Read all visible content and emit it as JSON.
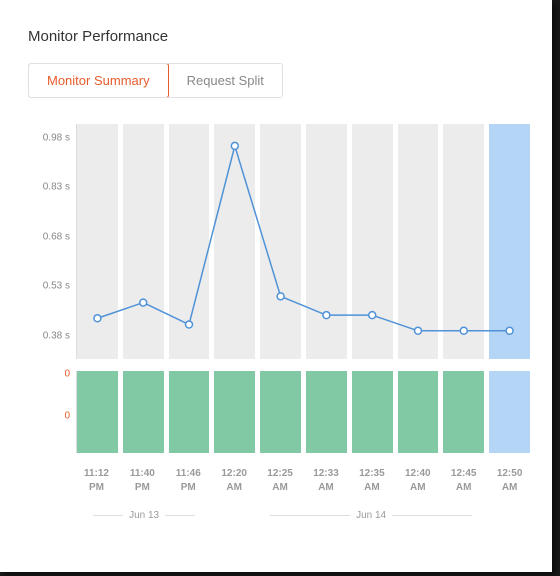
{
  "title": "Monitor Performance",
  "tabs": [
    {
      "label": "Monitor Summary",
      "active": true
    },
    {
      "label": "Request Split",
      "active": false
    }
  ],
  "chart_data": [
    {
      "type": "line",
      "ylabel": "",
      "yticks": [
        "0.98 s",
        "0.83 s",
        "0.68 s",
        "0.53 s",
        "0.38 s"
      ],
      "ylim": [
        0.3,
        1.05
      ],
      "categories": [
        "11:12 PM",
        "11:40 PM",
        "11:46 PM",
        "12:20 AM",
        "12:25 AM",
        "12:33 AM",
        "12:35 AM",
        "12:40 AM",
        "12:45 AM",
        "12:50 AM"
      ],
      "values": [
        0.43,
        0.48,
        0.41,
        0.98,
        0.5,
        0.44,
        0.44,
        0.39,
        0.39,
        0.39
      ],
      "highlight_index": 9
    },
    {
      "type": "bar",
      "ylabel": "",
      "yticks": [
        "0",
        "0"
      ],
      "ylim": [
        0,
        1
      ],
      "categories": [
        "11:12 PM",
        "11:40 PM",
        "11:46 PM",
        "12:20 AM",
        "12:25 AM",
        "12:33 AM",
        "12:35 AM",
        "12:40 AM",
        "12:45 AM",
        "12:50 AM"
      ],
      "values": [
        1,
        1,
        1,
        1,
        1,
        1,
        1,
        1,
        1,
        0
      ],
      "highlight_index": 9
    }
  ],
  "x_times": [
    "11:12",
    "11:40",
    "11:46",
    "12:20",
    "12:25",
    "12:33",
    "12:35",
    "12:40",
    "12:45",
    "12:50"
  ],
  "x_ampm": [
    "PM",
    "PM",
    "PM",
    "AM",
    "AM",
    "AM",
    "AM",
    "AM",
    "AM",
    "AM"
  ],
  "day_markers": [
    {
      "label": "Jun 13",
      "span": 3
    },
    {
      "label": "Jun 14",
      "span": 7
    }
  ],
  "colors": {
    "accent": "#e65c2b",
    "line": "#4f92d8",
    "bar": "#80c9a4",
    "highlight": "#b4d5f5"
  }
}
